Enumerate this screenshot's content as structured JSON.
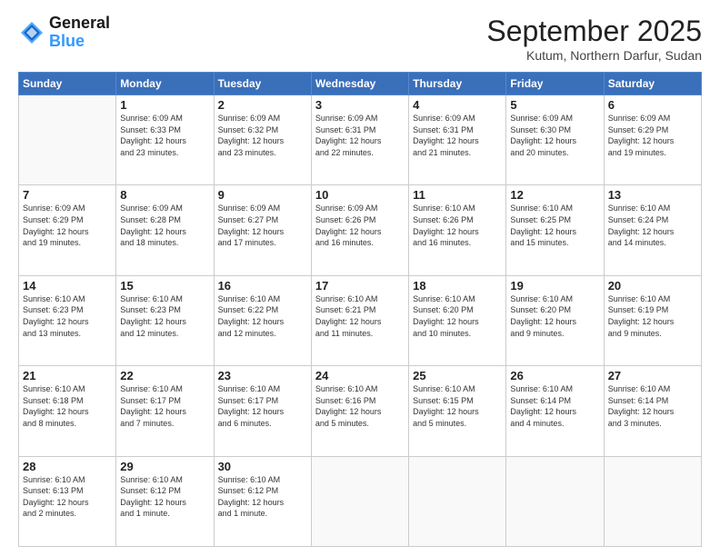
{
  "logo": {
    "line1": "General",
    "line2": "Blue"
  },
  "header": {
    "month": "September 2025",
    "location": "Kutum, Northern Darfur, Sudan"
  },
  "weekdays": [
    "Sunday",
    "Monday",
    "Tuesday",
    "Wednesday",
    "Thursday",
    "Friday",
    "Saturday"
  ],
  "weeks": [
    [
      {
        "day": null
      },
      {
        "day": 1,
        "sunrise": "6:09 AM",
        "sunset": "6:33 PM",
        "daylight": "12 hours and 23 minutes."
      },
      {
        "day": 2,
        "sunrise": "6:09 AM",
        "sunset": "6:32 PM",
        "daylight": "12 hours and 23 minutes."
      },
      {
        "day": 3,
        "sunrise": "6:09 AM",
        "sunset": "6:31 PM",
        "daylight": "12 hours and 22 minutes."
      },
      {
        "day": 4,
        "sunrise": "6:09 AM",
        "sunset": "6:31 PM",
        "daylight": "12 hours and 21 minutes."
      },
      {
        "day": 5,
        "sunrise": "6:09 AM",
        "sunset": "6:30 PM",
        "daylight": "12 hours and 20 minutes."
      },
      {
        "day": 6,
        "sunrise": "6:09 AM",
        "sunset": "6:29 PM",
        "daylight": "12 hours and 19 minutes."
      }
    ],
    [
      {
        "day": 7,
        "sunrise": "6:09 AM",
        "sunset": "6:29 PM",
        "daylight": "12 hours and 19 minutes."
      },
      {
        "day": 8,
        "sunrise": "6:09 AM",
        "sunset": "6:28 PM",
        "daylight": "12 hours and 18 minutes."
      },
      {
        "day": 9,
        "sunrise": "6:09 AM",
        "sunset": "6:27 PM",
        "daylight": "12 hours and 17 minutes."
      },
      {
        "day": 10,
        "sunrise": "6:09 AM",
        "sunset": "6:26 PM",
        "daylight": "12 hours and 16 minutes."
      },
      {
        "day": 11,
        "sunrise": "6:10 AM",
        "sunset": "6:26 PM",
        "daylight": "12 hours and 16 minutes."
      },
      {
        "day": 12,
        "sunrise": "6:10 AM",
        "sunset": "6:25 PM",
        "daylight": "12 hours and 15 minutes."
      },
      {
        "day": 13,
        "sunrise": "6:10 AM",
        "sunset": "6:24 PM",
        "daylight": "12 hours and 14 minutes."
      }
    ],
    [
      {
        "day": 14,
        "sunrise": "6:10 AM",
        "sunset": "6:23 PM",
        "daylight": "12 hours and 13 minutes."
      },
      {
        "day": 15,
        "sunrise": "6:10 AM",
        "sunset": "6:23 PM",
        "daylight": "12 hours and 12 minutes."
      },
      {
        "day": 16,
        "sunrise": "6:10 AM",
        "sunset": "6:22 PM",
        "daylight": "12 hours and 12 minutes."
      },
      {
        "day": 17,
        "sunrise": "6:10 AM",
        "sunset": "6:21 PM",
        "daylight": "12 hours and 11 minutes."
      },
      {
        "day": 18,
        "sunrise": "6:10 AM",
        "sunset": "6:20 PM",
        "daylight": "12 hours and 10 minutes."
      },
      {
        "day": 19,
        "sunrise": "6:10 AM",
        "sunset": "6:20 PM",
        "daylight": "12 hours and 9 minutes."
      },
      {
        "day": 20,
        "sunrise": "6:10 AM",
        "sunset": "6:19 PM",
        "daylight": "12 hours and 9 minutes."
      }
    ],
    [
      {
        "day": 21,
        "sunrise": "6:10 AM",
        "sunset": "6:18 PM",
        "daylight": "12 hours and 8 minutes."
      },
      {
        "day": 22,
        "sunrise": "6:10 AM",
        "sunset": "6:17 PM",
        "daylight": "12 hours and 7 minutes."
      },
      {
        "day": 23,
        "sunrise": "6:10 AM",
        "sunset": "6:17 PM",
        "daylight": "12 hours and 6 minutes."
      },
      {
        "day": 24,
        "sunrise": "6:10 AM",
        "sunset": "6:16 PM",
        "daylight": "12 hours and 5 minutes."
      },
      {
        "day": 25,
        "sunrise": "6:10 AM",
        "sunset": "6:15 PM",
        "daylight": "12 hours and 5 minutes."
      },
      {
        "day": 26,
        "sunrise": "6:10 AM",
        "sunset": "6:14 PM",
        "daylight": "12 hours and 4 minutes."
      },
      {
        "day": 27,
        "sunrise": "6:10 AM",
        "sunset": "6:14 PM",
        "daylight": "12 hours and 3 minutes."
      }
    ],
    [
      {
        "day": 28,
        "sunrise": "6:10 AM",
        "sunset": "6:13 PM",
        "daylight": "12 hours and 2 minutes."
      },
      {
        "day": 29,
        "sunrise": "6:10 AM",
        "sunset": "6:12 PM",
        "daylight": "12 hours and 1 minute."
      },
      {
        "day": 30,
        "sunrise": "6:10 AM",
        "sunset": "6:12 PM",
        "daylight": "12 hours and 1 minute."
      },
      {
        "day": null
      },
      {
        "day": null
      },
      {
        "day": null
      },
      {
        "day": null
      }
    ]
  ]
}
